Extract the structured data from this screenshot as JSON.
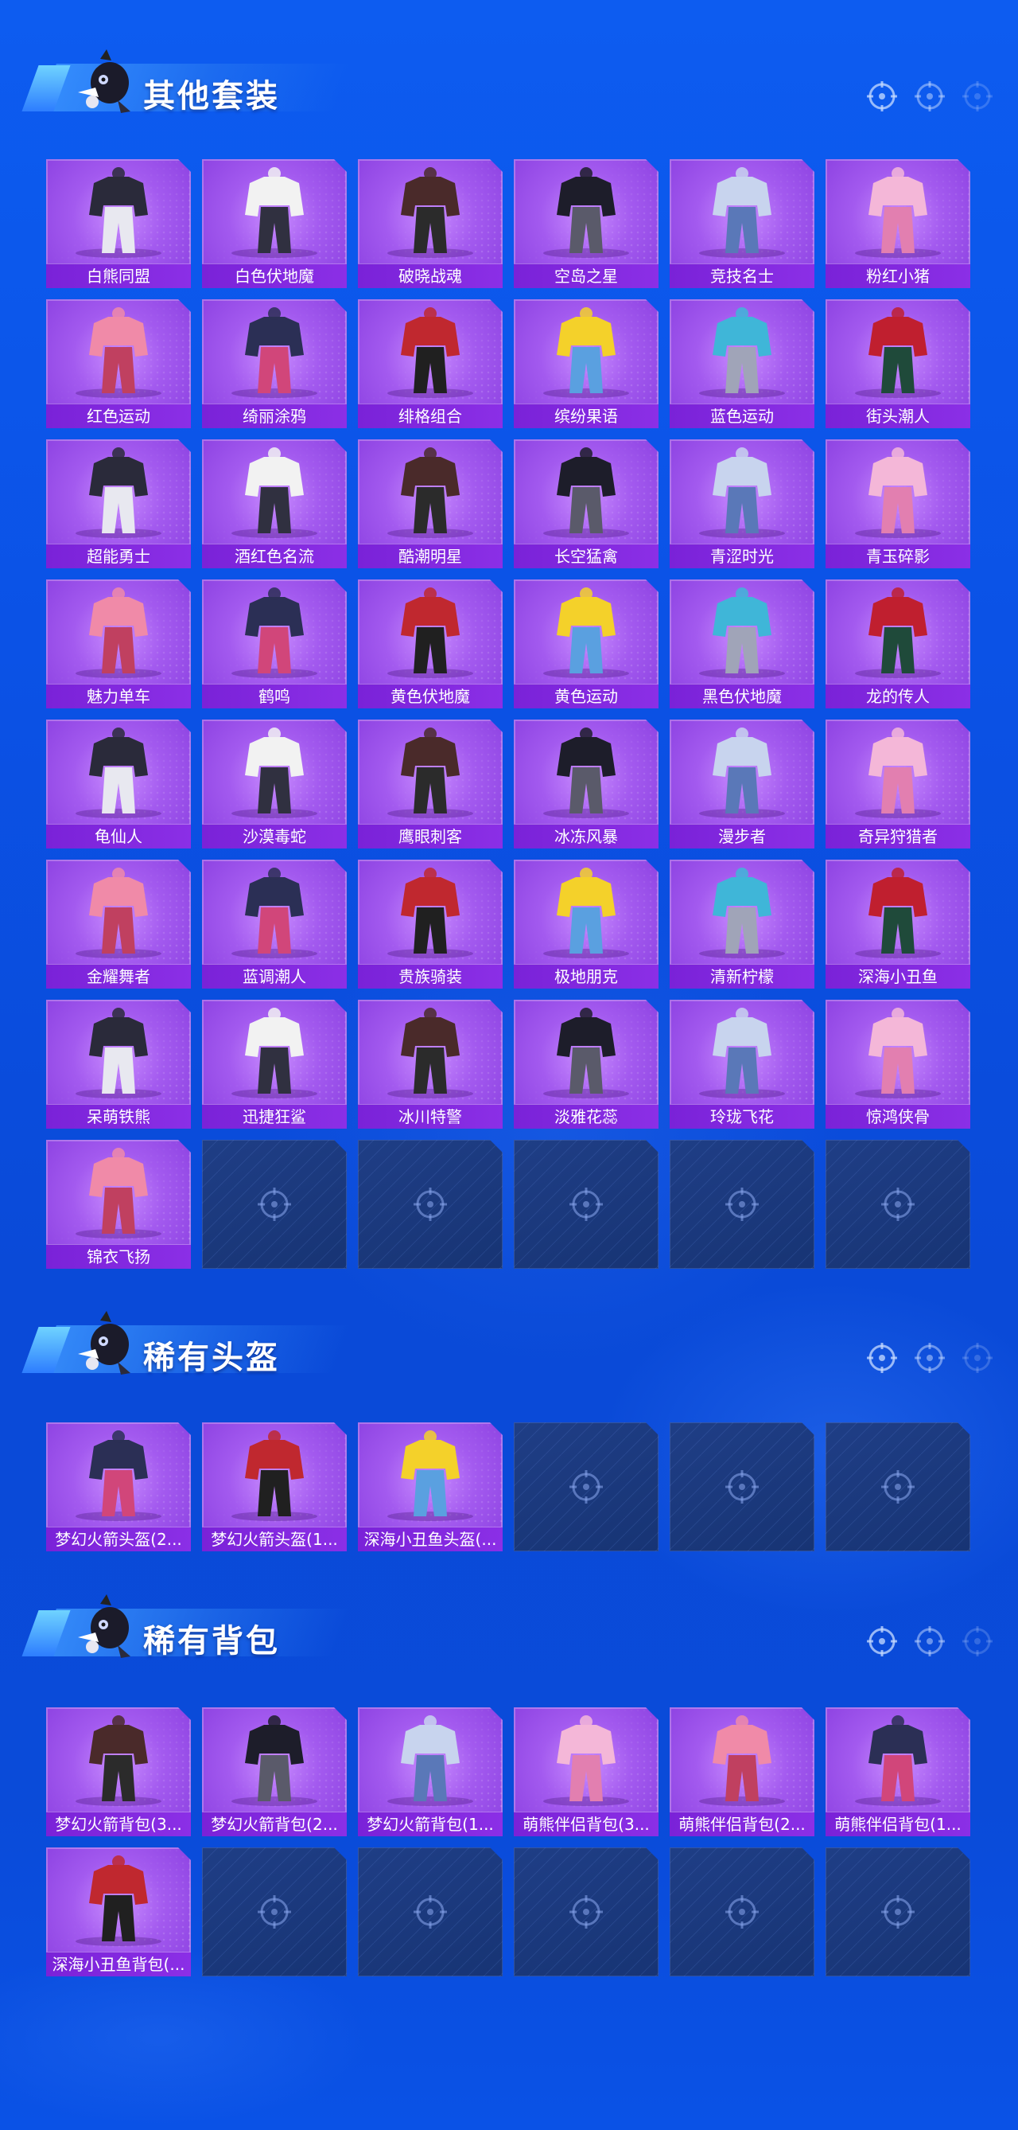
{
  "sections": [
    {
      "title": "其他套装",
      "items": [
        "白熊同盟",
        "白色伏地魔",
        "破晓战魂",
        "空岛之星",
        "竞技名士",
        "粉红小猪",
        "红色运动",
        "绮丽涂鸦",
        "绯格组合",
        "缤纷果语",
        "蓝色运动",
        "街头潮人",
        "超能勇士",
        "酒红色名流",
        "酷潮明星",
        "长空猛禽",
        "青涩时光",
        "青玉碎影",
        "魅力单车",
        "鹤鸣",
        "黄色伏地魔",
        "黄色运动",
        "黑色伏地魔",
        "龙的传人",
        "龟仙人",
        "沙漠毒蛇",
        "鹰眼刺客",
        "冰冻风暴",
        "漫步者",
        "奇异狩猎者",
        "金耀舞者",
        "蓝调潮人",
        "贵族骑装",
        "极地朋克",
        "清新柠檬",
        "深海小丑鱼",
        "呆萌铁熊",
        "迅捷狂鲨",
        "冰川特警",
        "淡雅花蕊",
        "玲珑飞花",
        "惊鸿侠骨",
        "锦衣飞扬"
      ],
      "empty_slots": 5
    },
    {
      "title": "稀有头盔",
      "items": [
        "梦幻火箭头盔(2...",
        "梦幻火箭头盔(1...",
        "深海小丑鱼头盔(..."
      ],
      "empty_slots": 3
    },
    {
      "title": "稀有背包",
      "items": [
        "梦幻火箭背包(3...",
        "梦幻火箭背包(2...",
        "梦幻火箭背包(1...",
        "萌熊伴侣背包(3...",
        "萌熊伴侣背包(2...",
        "萌熊伴侣背包(1...",
        "深海小丑鱼背包(..."
      ],
      "empty_slots": 5
    }
  ],
  "colors": {
    "card_purple": "#a35aef",
    "label_purple": "#7a22d8",
    "empty_slot": "#1f3e86",
    "background": "#0b52e6"
  },
  "icons": {
    "header_mascot": "mascot-icon",
    "header_targets": "crosshair-icon",
    "empty_placeholder": "crosshair-icon"
  }
}
